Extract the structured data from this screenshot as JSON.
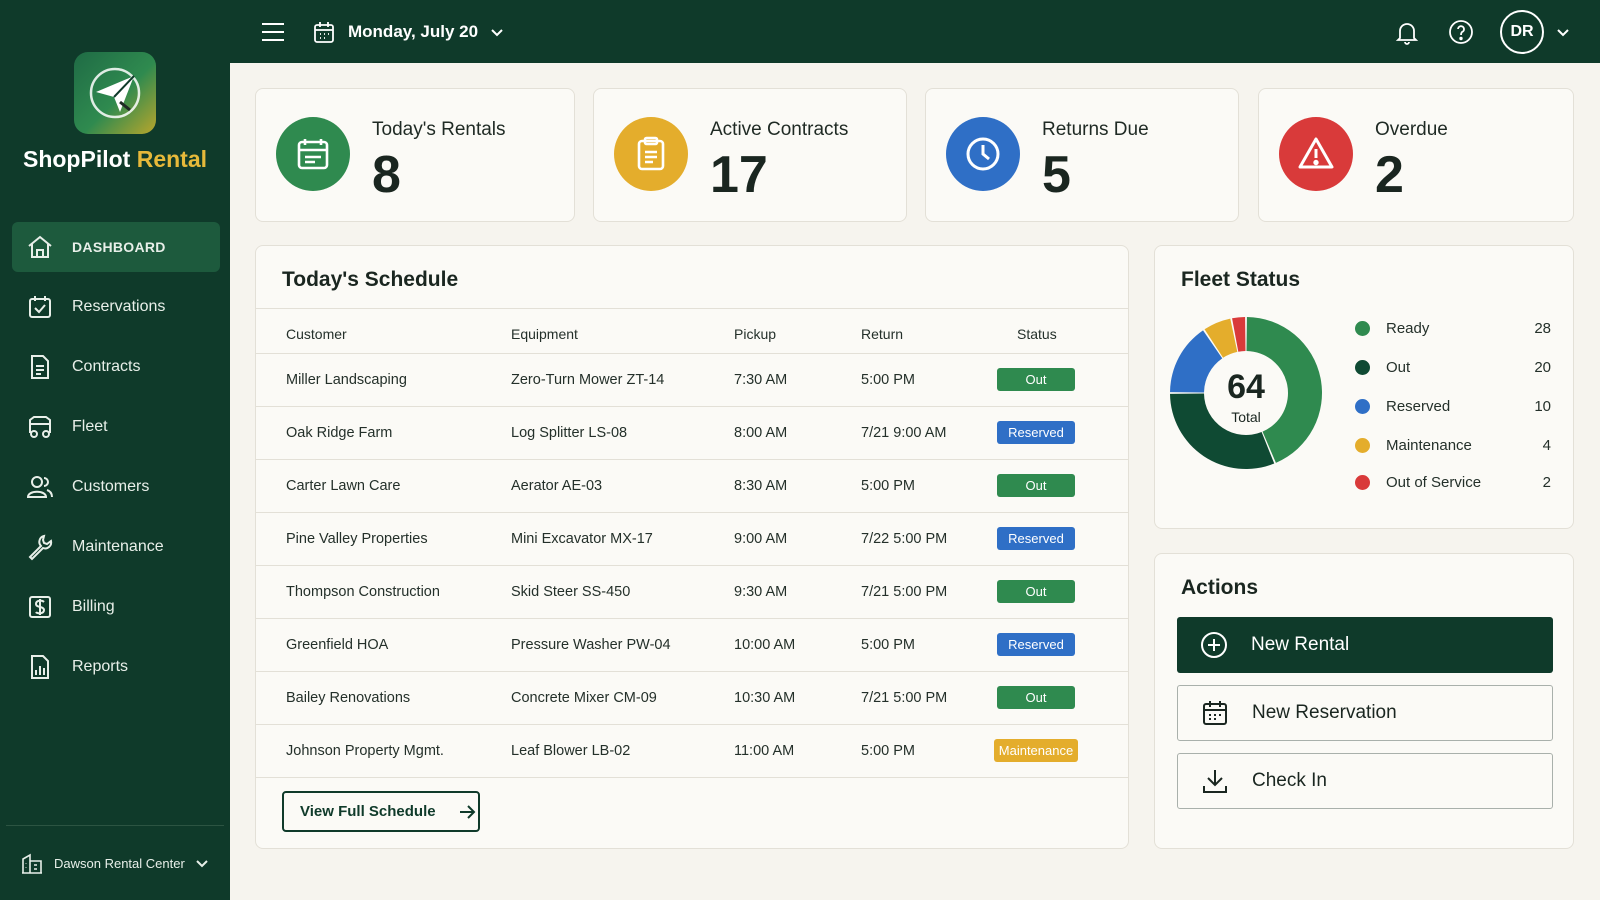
{
  "colors": {
    "sidebar_bg": "#0f3a2a",
    "accent_gold": "#e6b93a",
    "green": "#2f8a4f",
    "blue": "#2f6fc6",
    "yellow": "#e4ad2c",
    "red": "#d93a3a"
  },
  "brand": {
    "name": "ShopPilot",
    "accent": "Rental"
  },
  "sidebar": {
    "items": [
      {
        "label": "DASHBOARD",
        "icon": "home-icon",
        "active": true
      },
      {
        "label": "Reservations",
        "icon": "calendar-check-icon"
      },
      {
        "label": "Contracts",
        "icon": "document-icon"
      },
      {
        "label": "Fleet",
        "icon": "truck-icon"
      },
      {
        "label": "Customers",
        "icon": "users-icon"
      },
      {
        "label": "Maintenance",
        "icon": "wrench-icon"
      },
      {
        "label": "Billing",
        "icon": "dollar-icon"
      },
      {
        "label": "Reports",
        "icon": "bar-chart-icon"
      }
    ],
    "location": "Dawson Rental Center"
  },
  "topbar": {
    "date": "Monday, July 20",
    "avatar_initials": "DR"
  },
  "kpis": [
    {
      "label": "Today's Rentals",
      "value": "8",
      "icon": "clipboard-calendar-icon"
    },
    {
      "label": "Active Contracts",
      "value": "17",
      "icon": "clipboard-icon"
    },
    {
      "label": "Returns Due",
      "value": "5",
      "icon": "clock-icon"
    },
    {
      "label": "Overdue",
      "value": "2",
      "icon": "warning-icon"
    }
  ],
  "schedule": {
    "title": "Today's Schedule",
    "columns": [
      "Customer",
      "Equipment",
      "Pickup",
      "Return",
      "Status"
    ],
    "rows": [
      {
        "customer": "Miller Landscaping",
        "equipment": "Zero-Turn Mower ZT-14",
        "pickup": "7:30 AM",
        "return": "5:00 PM",
        "status": "Out"
      },
      {
        "customer": "Oak Ridge Farm",
        "equipment": "Log Splitter LS-08",
        "pickup": "8:00 AM",
        "return": "7/21 9:00 AM",
        "status": "Reserved"
      },
      {
        "customer": "Carter Lawn Care",
        "equipment": "Aerator AE-03",
        "pickup": "8:30 AM",
        "return": "5:00 PM",
        "status": "Out"
      },
      {
        "customer": "Pine Valley Properties",
        "equipment": "Mini Excavator MX-17",
        "pickup": "9:00 AM",
        "return": "7/22 5:00 PM",
        "status": "Reserved"
      },
      {
        "customer": "Thompson Construction",
        "equipment": "Skid Steer SS-450",
        "pickup": "9:30 AM",
        "return": "7/21 5:00 PM",
        "status": "Out"
      },
      {
        "customer": "Greenfield HOA",
        "equipment": "Pressure Washer PW-04",
        "pickup": "10:00 AM",
        "return": "5:00 PM",
        "status": "Reserved"
      },
      {
        "customer": "Bailey Renovations",
        "equipment": "Concrete Mixer CM-09",
        "pickup": "10:30 AM",
        "return": "7/21 5:00 PM",
        "status": "Out"
      },
      {
        "customer": "Johnson Property Mgmt.",
        "equipment": "Leaf Blower LB-02",
        "pickup": "11:00 AM",
        "return": "5:00 PM",
        "status": "Maintenance"
      }
    ],
    "view_all_label": "View Full Schedule"
  },
  "fleet": {
    "title": "Fleet Status",
    "total": "64",
    "total_label": "Total",
    "segments": [
      {
        "label": "Ready",
        "value": 28,
        "color": "#2f8a4f"
      },
      {
        "label": "Out",
        "value": 20,
        "color": "#0f4a33"
      },
      {
        "label": "Reserved",
        "value": 10,
        "color": "#2f6fc6"
      },
      {
        "label": "Maintenance",
        "value": 4,
        "color": "#e4ad2c"
      },
      {
        "label": "Out of Service",
        "value": 2,
        "color": "#d93a3a"
      }
    ]
  },
  "actions": {
    "title": "Actions",
    "buttons": [
      {
        "label": "New Rental",
        "icon": "plus-circle-icon"
      },
      {
        "label": "New Reservation",
        "icon": "calendar-icon"
      },
      {
        "label": "Check In",
        "icon": "download-icon"
      }
    ]
  }
}
